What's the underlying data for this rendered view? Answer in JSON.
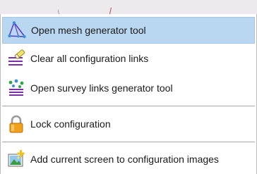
{
  "menu": {
    "items": [
      {
        "label": "Open mesh generator tool",
        "icon": "mesh-generator-icon",
        "highlighted": true
      },
      {
        "label": "Clear all configuration links",
        "icon": "clear-links-icon",
        "highlighted": false
      },
      {
        "label": "Open survey links generator tool",
        "icon": "survey-links-icon",
        "highlighted": false
      },
      {
        "label": "Lock configuration",
        "icon": "lock-icon",
        "highlighted": false
      },
      {
        "label": "Add current screen to configuration images",
        "icon": "add-screen-image-icon",
        "highlighted": false
      }
    ]
  },
  "colors": {
    "highlight": "#b9d7f0",
    "separator": "#a8a8a8",
    "top_strip": "#eceaec"
  }
}
